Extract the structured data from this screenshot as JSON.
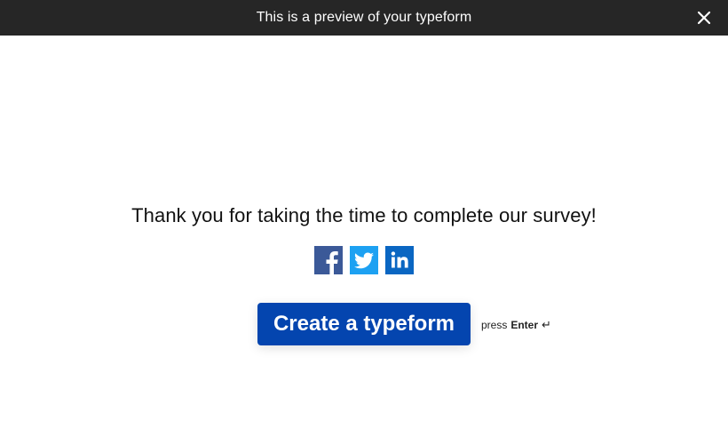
{
  "banner": {
    "text": "This is a preview of your typeform",
    "close_icon": "close-icon"
  },
  "main": {
    "thank_you": "Thank you for taking the time to complete our survey!",
    "social": [
      {
        "name": "facebook",
        "icon": "facebook-icon",
        "color": "#3B5998"
      },
      {
        "name": "twitter",
        "icon": "twitter-icon",
        "color": "#1DA1F2"
      },
      {
        "name": "linkedin",
        "icon": "linkedin-icon",
        "color": "#0A66C2"
      }
    ],
    "cta_label": "Create a typeform",
    "hint_press": "press",
    "hint_key": "Enter",
    "hint_icon": "↵",
    "accent_color": "#0445AF"
  }
}
